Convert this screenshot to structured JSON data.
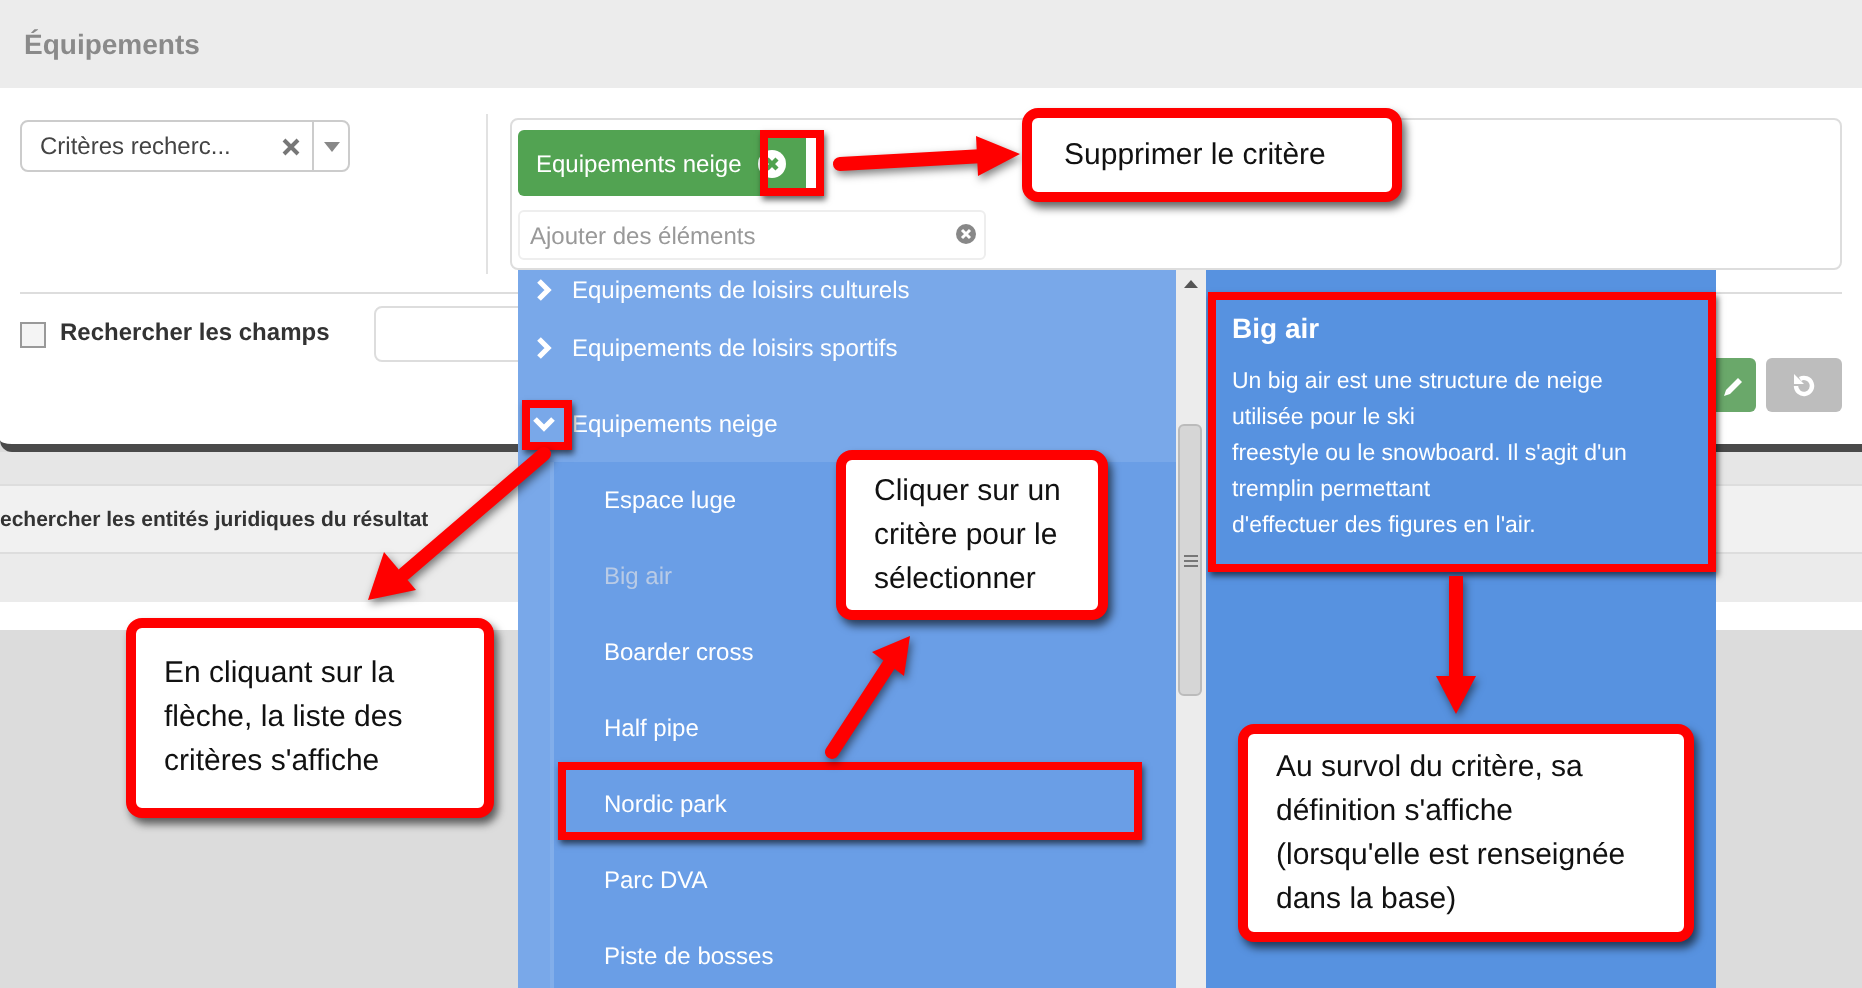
{
  "dialog": {
    "title": "Équipements"
  },
  "criteria_select": {
    "value": "Critères recherc..."
  },
  "tag_field": {
    "tags": [
      {
        "label": "Equipements neige"
      }
    ],
    "placeholder": "Ajouter des éléments"
  },
  "search_fields": {
    "label": "Rechercher les champs",
    "checked": false
  },
  "result_row": {
    "label": "echercher les entités juridiques du résultat"
  },
  "dropdown": {
    "items": [
      {
        "label": "Equipements de loisirs culturels",
        "expanded": false
      },
      {
        "label": "Equipements de loisirs sportifs",
        "expanded": false
      },
      {
        "label": "Equipements neige",
        "expanded": true,
        "children": [
          {
            "label": "Espace luge",
            "hovered": false
          },
          {
            "label": "Big air",
            "hovered": true
          },
          {
            "label": "Boarder cross",
            "hovered": false
          },
          {
            "label": "Half pipe",
            "hovered": false
          },
          {
            "label": "Nordic park",
            "hovered": false
          },
          {
            "label": "Parc DVA",
            "hovered": false
          },
          {
            "label": "Piste de bosses",
            "hovered": false
          }
        ]
      }
    ]
  },
  "definition": {
    "title": "Big air",
    "lines": [
      "Un big air est une structure de neige",
      "utilisée pour le ski",
      "freestyle ou le snowboard. Il s'agit d'un",
      "tremplin permettant",
      "d'effectuer des figures en l'air."
    ]
  },
  "annotations": [
    {
      "lines": [
        "Supprimer le critère"
      ]
    },
    {
      "lines": [
        "En cliquant sur la",
        "flèche, la liste des",
        "critères s'affiche"
      ]
    },
    {
      "lines": [
        "Cliquer sur un",
        "critère pour le",
        "sélectionner"
      ]
    },
    {
      "lines": [
        "Au survol du critère, sa",
        "définition s'affiche",
        "(lorsqu'elle est renseignée",
        "dans la base)"
      ]
    }
  ]
}
